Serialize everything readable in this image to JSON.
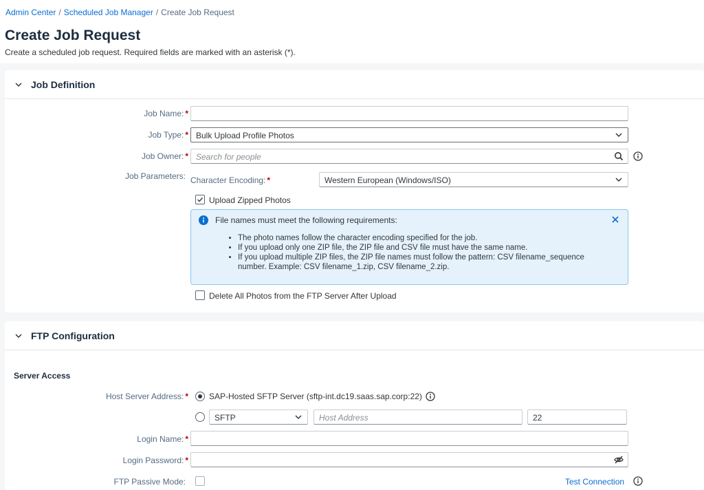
{
  "breadcrumb": {
    "items": [
      "Admin Center",
      "Scheduled Job Manager",
      "Create Job Request"
    ],
    "separator": "/"
  },
  "page": {
    "title": "Create Job Request",
    "subtitle": "Create a scheduled job request. Required fields are marked with an asterisk (*)."
  },
  "job_definition": {
    "section_title": "Job Definition",
    "required_marker": "*",
    "job_name": {
      "label": "Job Name:",
      "value": ""
    },
    "job_type": {
      "label": "Job Type:",
      "value": "Bulk Upload Profile Photos"
    },
    "job_owner": {
      "label": "Job Owner:",
      "placeholder": "Search for people"
    },
    "job_parameters": {
      "label": "Job Parameters:",
      "character_encoding": {
        "label": "Character Encoding:",
        "value": "Western European (Windows/ISO)"
      },
      "upload_zipped": {
        "label": "Upload Zipped Photos",
        "checked": true
      },
      "info_message": {
        "title": "File names must meet the following requirements:",
        "items": [
          "The photo names follow the character encoding specified for the job.",
          "If you upload only one ZIP file, the ZIP file and CSV file must have the same name.",
          "If you upload multiple ZIP files, the ZIP file names must follow the pattern: CSV filename_sequence number. Example: CSV filename_1.zip, CSV filename_2.zip."
        ]
      },
      "delete_photos": {
        "label": "Delete All Photos from the FTP Server After Upload",
        "checked": false
      }
    }
  },
  "ftp_configuration": {
    "section_title": "FTP Configuration",
    "server_access_title": "Server Access",
    "host_server": {
      "label": "Host Server Address:",
      "option_hosted": "SAP-Hosted SFTP Server (sftp-int.dc19.saas.sap.corp:22)",
      "protocol": "SFTP",
      "host_placeholder": "Host Address",
      "port": "22"
    },
    "login_name": {
      "label": "Login Name:",
      "value": ""
    },
    "login_password": {
      "label": "Login Password:",
      "value": ""
    },
    "passive_mode": {
      "label": "FTP Passive Mode:",
      "checked": false
    },
    "test_connection": "Test Connection"
  },
  "colors": {
    "accent": "#0a6ed1",
    "required": "#bb0000",
    "highlight": "#fbf524",
    "info_bg": "#e5f2fc"
  },
  "icons": {
    "collapse": "chevron-down-icon",
    "dropdown": "chevron-down-icon",
    "search": "search-icon",
    "info": "info-icon",
    "close": "close-icon",
    "password_toggle": "eye-slash-icon"
  }
}
